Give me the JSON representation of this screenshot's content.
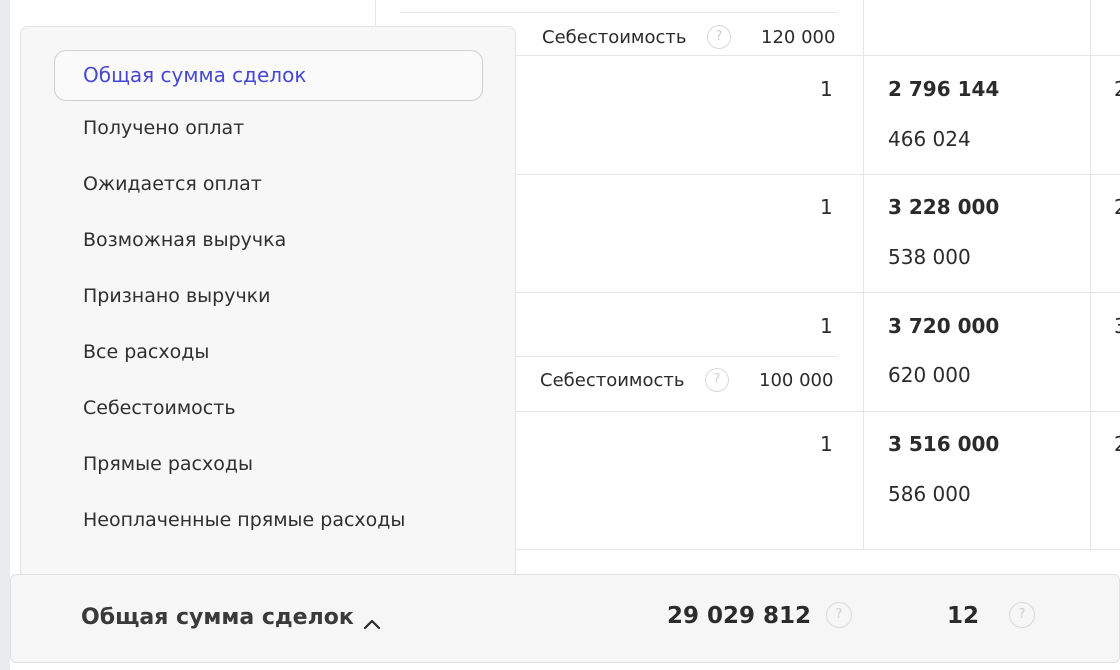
{
  "table": {
    "rows": [
      {
        "cost_label": "Себестоимость",
        "cost_value": "120 000"
      },
      {
        "count": "1",
        "amount_bold": "2 796 144",
        "amount_sub": "466 024",
        "edge_char": "2"
      },
      {
        "count": "1",
        "amount_bold": "3 228 000",
        "amount_sub": "538 000",
        "edge_char": "2"
      },
      {
        "count": "1",
        "amount_bold": "3 720 000",
        "amount_sub": "620 000",
        "edge_char": "3",
        "cost_label": "Себестоимость",
        "cost_value": "100 000"
      },
      {
        "count": "1",
        "amount_bold": "3 516 000",
        "amount_sub": "586 000",
        "edge_char": "2"
      }
    ],
    "help_glyph": "?"
  },
  "dropdown": {
    "selected": "Общая сумма сделок",
    "items": [
      "Получено оплат",
      "Ожидается оплат",
      "Возможная выручка",
      "Признано выручки",
      "Все расходы",
      "Себестоимость",
      "Прямые расходы",
      "Неоплаченные прямые расходы"
    ]
  },
  "footer": {
    "label": "Общая сумма сделок",
    "total": "29 029 812",
    "count": "12",
    "help_glyph": "?"
  },
  "colors": {
    "accent": "#4747d6",
    "background": "#e9ecef",
    "panel": "#f7f7f8"
  }
}
